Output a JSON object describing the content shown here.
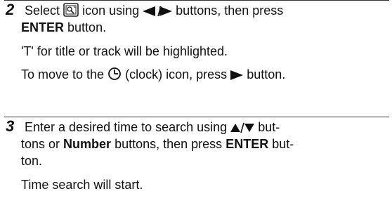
{
  "step1": {
    "number": "2",
    "line1_before": "Select",
    "icon_desc": "search-menu-icon",
    "line1_mid": "icon using",
    "line1_after": "buttons, then press",
    "line2_bold": "ENTER",
    "line2_after": "button.",
    "note1": "'T' for title or track will be highlighted.",
    "note2_before": "To move to the",
    "note2_mid": "(clock) icon, press",
    "note2_after": "button."
  },
  "step2": {
    "number": "3",
    "line1_before": "Enter a desired time to search using",
    "line1_after": "but-",
    "line2_before": "tons or",
    "line2_bold1": "Number",
    "line2_mid": "buttons, then press",
    "line2_bold2": "ENTER",
    "line2_after": "but-",
    "line3": "ton.",
    "note1": "Time search will start."
  },
  "icons": {
    "left_right": "left-right-arrow-icon",
    "right": "right-arrow-icon",
    "clock": "clock-icon",
    "up_down": "up-down-arrow-icon"
  }
}
